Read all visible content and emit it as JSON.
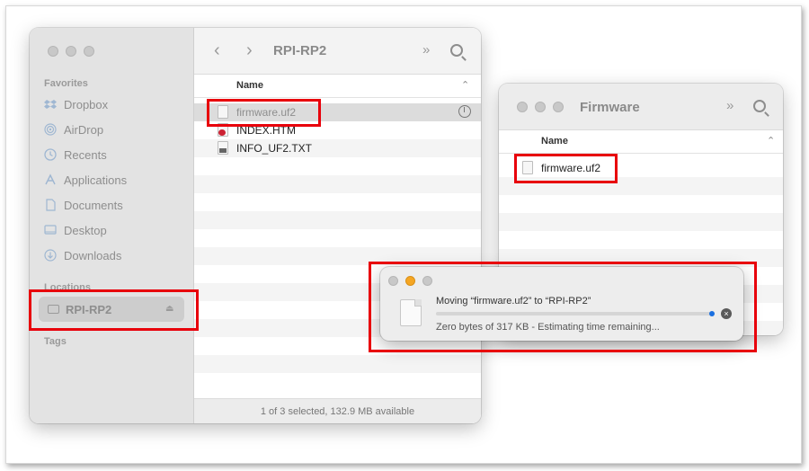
{
  "finder_main": {
    "sidebar": {
      "favorites_heading": "Favorites",
      "favorites": [
        {
          "label": "Dropbox",
          "icon": "dropbox-icon"
        },
        {
          "label": "AirDrop",
          "icon": "airdrop-icon"
        },
        {
          "label": "Recents",
          "icon": "clock-icon"
        },
        {
          "label": "Applications",
          "icon": "applications-icon"
        },
        {
          "label": "Documents",
          "icon": "document-icon"
        },
        {
          "label": "Desktop",
          "icon": "desktop-icon"
        },
        {
          "label": "Downloads",
          "icon": "download-icon"
        }
      ],
      "locations_heading": "Locations",
      "locations": [
        {
          "label": "RPI-RP2",
          "icon": "external-disk-icon",
          "selected": true
        }
      ],
      "tags_heading": "Tags"
    },
    "toolbar": {
      "title": "RPI-RP2",
      "back": "‹",
      "forward": "›",
      "more": "»"
    },
    "column_name": "Name",
    "files": [
      {
        "name": "firmware.uf2",
        "selected": true,
        "copying": true
      },
      {
        "name": "INDEX.HTM"
      },
      {
        "name": "INFO_UF2.TXT"
      }
    ],
    "status": "1 of 3 selected, 132.9 MB available"
  },
  "finder_firmware": {
    "title": "Firmware",
    "column_name": "Name",
    "files": [
      {
        "name": "firmware.uf2"
      }
    ],
    "more": "»"
  },
  "copy_dialog": {
    "title": "Moving “firmware.uf2” to “RPI-RP2”",
    "status": "Zero bytes of 317 KB - Estimating time remaining...",
    "progress": 0.0,
    "cancel": "×"
  },
  "colors": {
    "highlight": "#e8000b",
    "progress_knob": "#1a6fe0"
  }
}
